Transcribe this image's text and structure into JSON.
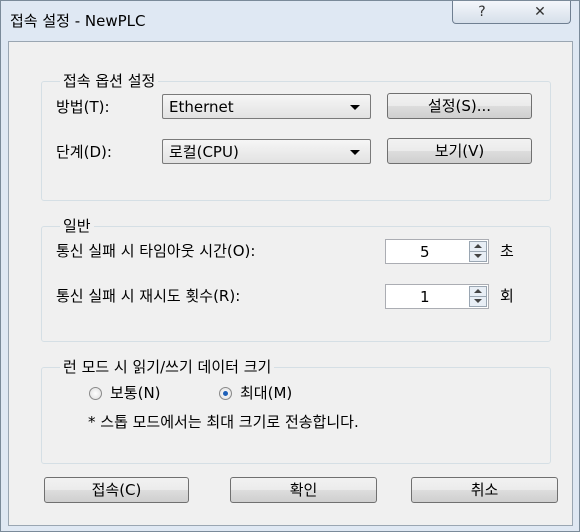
{
  "window": {
    "title": "접속 설정 - NewPLC",
    "help_glyph": "?",
    "close_glyph": "✕"
  },
  "connection_options": {
    "legend": "접속 옵션 설정",
    "method_label": "방법(T):",
    "method_value": "Ethernet",
    "settings_button": "설정(S)...",
    "level_label": "단계(D):",
    "level_value": "로컬(CPU)",
    "view_button": "보기(V)"
  },
  "general": {
    "legend": "일반",
    "timeout_label": "통신 실패 시 타임아웃 시간(O):",
    "timeout_value": "5",
    "timeout_unit": "초",
    "retry_label": "통신 실패 시 재시도 횟수(R):",
    "retry_value": "1",
    "retry_unit": "회"
  },
  "run_mode": {
    "legend": "런 모드 시 읽기/쓰기 데이터 크기",
    "option_normal": "보통(N)",
    "option_max": "최대(M)",
    "selected": "max",
    "note": "* 스톱 모드에서는 최대 크기로 전송합니다."
  },
  "footer": {
    "connect_button": "접속(C)",
    "ok_button": "확인",
    "cancel_button": "취소"
  }
}
